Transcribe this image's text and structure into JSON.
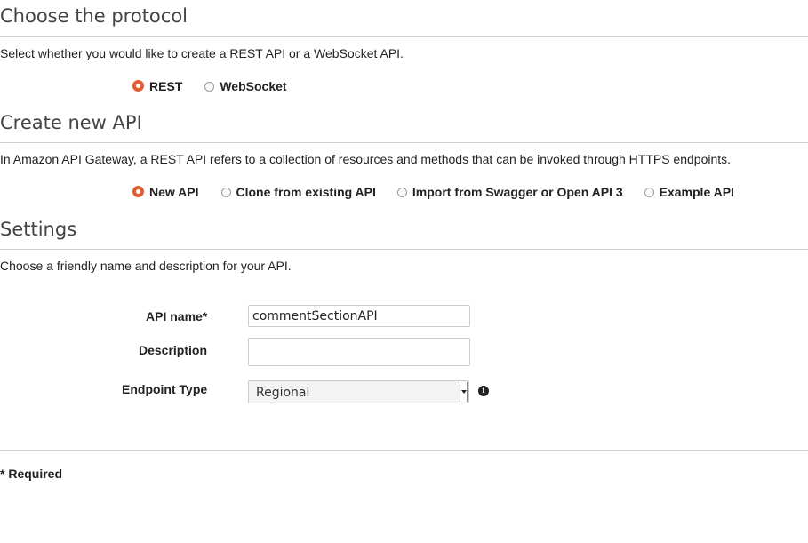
{
  "protocol": {
    "title": "Choose the protocol",
    "description": "Select whether you would like to create a REST API or a WebSocket API.",
    "options": [
      {
        "label": "REST",
        "selected": true
      },
      {
        "label": "WebSocket",
        "selected": false
      }
    ]
  },
  "create_api": {
    "title": "Create new API",
    "description": "In Amazon API Gateway, a REST API refers to a collection of resources and methods that can be invoked through HTTPS endpoints.",
    "options": [
      {
        "label": "New API",
        "selected": true
      },
      {
        "label": "Clone from existing API",
        "selected": false
      },
      {
        "label": "Import from Swagger or Open API 3",
        "selected": false
      },
      {
        "label": "Example API",
        "selected": false
      }
    ]
  },
  "settings": {
    "title": "Settings",
    "description": "Choose a friendly name and description for your API.",
    "api_name_label": "API name*",
    "api_name_value": "commentSectionAPI",
    "description_label": "Description",
    "description_value": "",
    "endpoint_type_label": "Endpoint Type",
    "endpoint_type_value": "Regional",
    "info_icon_glyph": "i"
  },
  "footer": {
    "required_note": "* Required"
  },
  "colors": {
    "radio_selected": "#e15d2f",
    "divider": "#cfcfcf",
    "heading": "#444444"
  }
}
